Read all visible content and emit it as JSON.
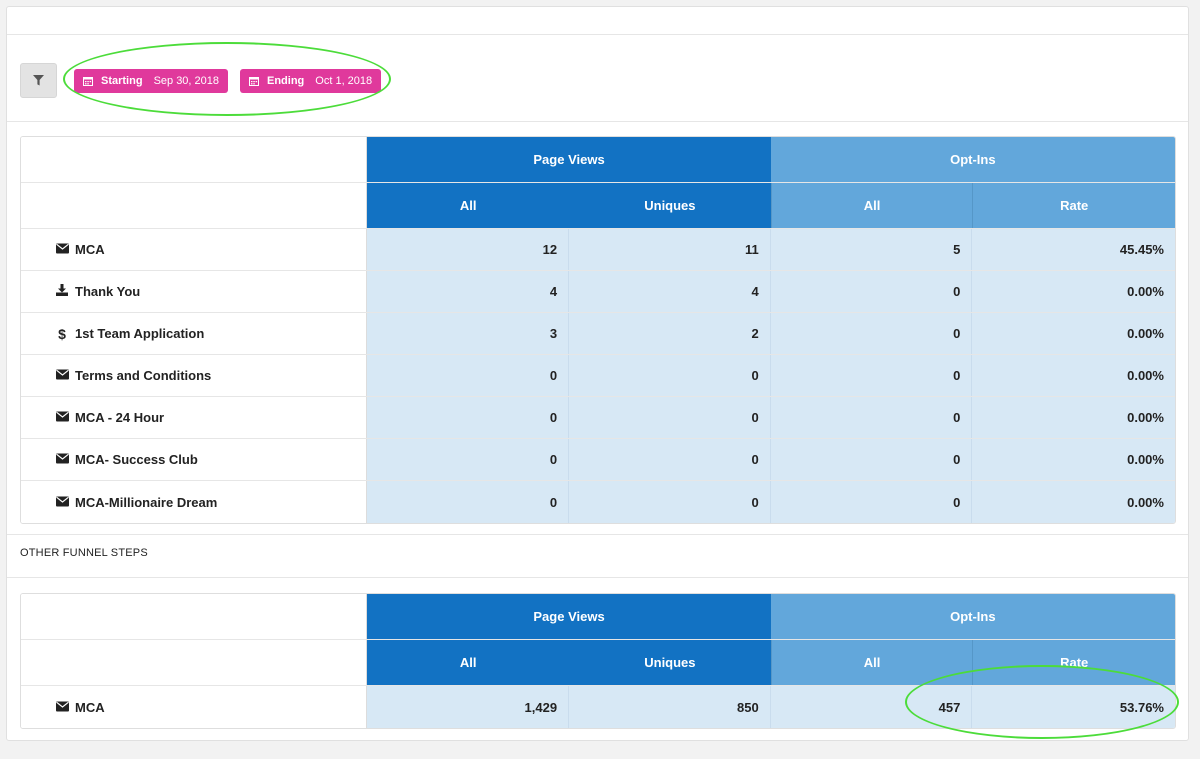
{
  "filter": {
    "starting_label": "Starting",
    "starting_date": "Sep 30, 2018",
    "ending_label": "Ending",
    "ending_date": "Oct 1, 2018"
  },
  "colors": {
    "accent_pink": "#e0399c",
    "page_views_header": "#1272c3",
    "opt_ins_header": "#62a7db",
    "cell_bg": "#d7e8f5",
    "highlight": "#4cdc3a"
  },
  "headers": {
    "page_views": "Page Views",
    "opt_ins": "Opt-Ins",
    "all": "All",
    "uniques": "Uniques",
    "rate": "Rate"
  },
  "main_table": {
    "rows": [
      {
        "icon": "envelope-icon",
        "name": "MCA",
        "pv_all": "12",
        "pv_uniques": "11",
        "oi_all": "5",
        "oi_rate": "45.45%"
      },
      {
        "icon": "download-icon",
        "name": "Thank You",
        "pv_all": "4",
        "pv_uniques": "4",
        "oi_all": "0",
        "oi_rate": "0.00%"
      },
      {
        "icon": "dollar-icon",
        "name": "1st Team Application",
        "pv_all": "3",
        "pv_uniques": "2",
        "oi_all": "0",
        "oi_rate": "0.00%"
      },
      {
        "icon": "envelope-icon",
        "name": "Terms and Conditions",
        "pv_all": "0",
        "pv_uniques": "0",
        "oi_all": "0",
        "oi_rate": "0.00%"
      },
      {
        "icon": "envelope-icon",
        "name": "MCA - 24 Hour",
        "pv_all": "0",
        "pv_uniques": "0",
        "oi_all": "0",
        "oi_rate": "0.00%"
      },
      {
        "icon": "envelope-icon",
        "name": "MCA- Success Club",
        "pv_all": "0",
        "pv_uniques": "0",
        "oi_all": "0",
        "oi_rate": "0.00%"
      },
      {
        "icon": "envelope-icon",
        "name": "MCA-Millionaire Dream",
        "pv_all": "0",
        "pv_uniques": "0",
        "oi_all": "0",
        "oi_rate": "0.00%"
      }
    ]
  },
  "other_section": {
    "label": "OTHER FUNNEL STEPS",
    "rows": [
      {
        "icon": "envelope-icon",
        "name": "MCA",
        "pv_all": "1,429",
        "pv_uniques": "850",
        "oi_all": "457",
        "oi_rate": "53.76%"
      }
    ]
  }
}
